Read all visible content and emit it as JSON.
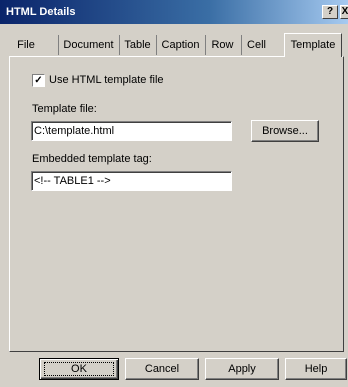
{
  "window": {
    "title": "HTML Details",
    "help_button": "?",
    "close_button": "X"
  },
  "tabs": [
    {
      "label": "File"
    },
    {
      "label": "Document"
    },
    {
      "label": "Table"
    },
    {
      "label": "Caption"
    },
    {
      "label": "Row"
    },
    {
      "label": "Cell"
    },
    {
      "label": "Template",
      "active": true
    }
  ],
  "template": {
    "use_template": {
      "label": "Use HTML template file",
      "checked": true
    },
    "template_file": {
      "label": "Template file:",
      "value": "C:\\template.html"
    },
    "browse": {
      "label": "Browse..."
    },
    "embedded_tag": {
      "label": "Embedded template tag:",
      "value": "<!-- TABLE1 -->"
    }
  },
  "buttons": {
    "ok": "OK",
    "cancel": "Cancel",
    "apply": "Apply",
    "help": "Help"
  },
  "colors": {
    "dialog_face": "#d4d0c8",
    "titlebar_start": "#0a246a",
    "titlebar_end": "#a6caf0"
  }
}
